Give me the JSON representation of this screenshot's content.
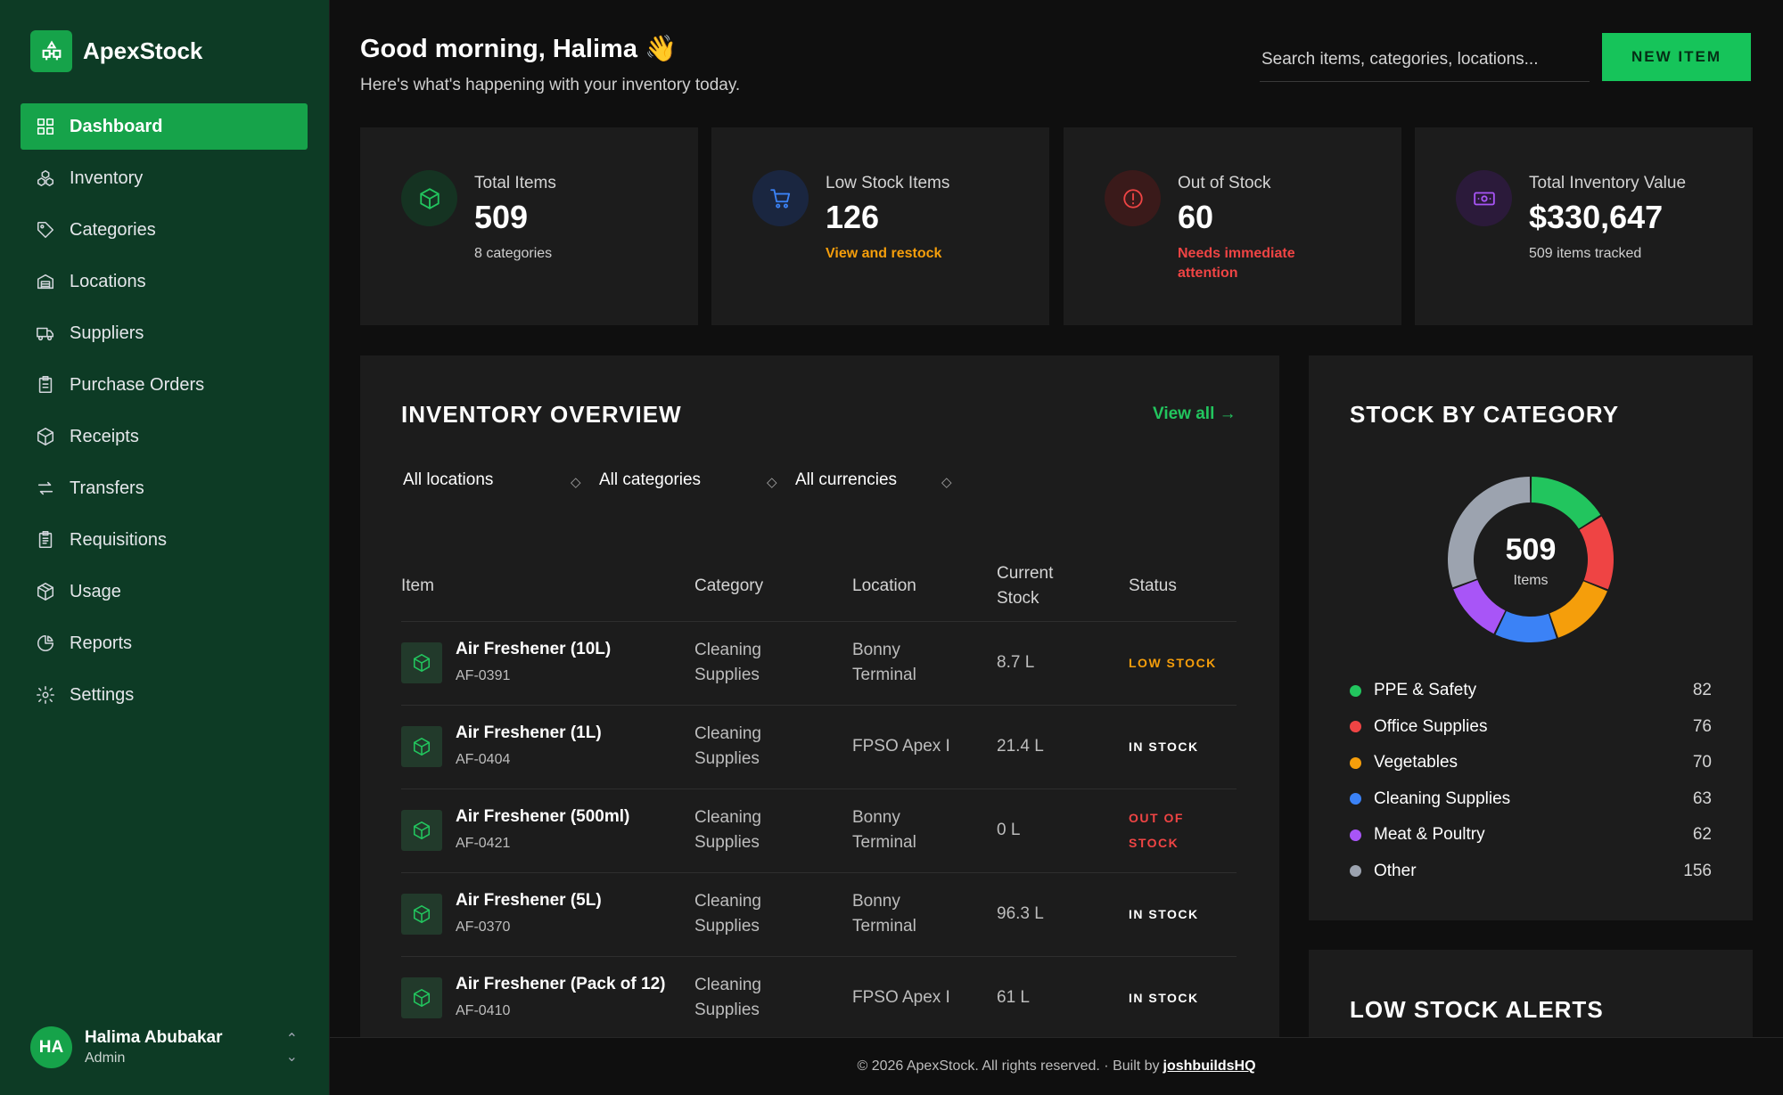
{
  "app": {
    "name": "ApexStock"
  },
  "sidebar": {
    "items": [
      {
        "label": "Dashboard",
        "icon": "dashboard-icon"
      },
      {
        "label": "Inventory",
        "icon": "boxes-icon"
      },
      {
        "label": "Categories",
        "icon": "tag-icon"
      },
      {
        "label": "Locations",
        "icon": "warehouse-icon"
      },
      {
        "label": "Suppliers",
        "icon": "truck-icon"
      },
      {
        "label": "Purchase Orders",
        "icon": "clipboard-icon"
      },
      {
        "label": "Receipts",
        "icon": "package-icon"
      },
      {
        "label": "Transfers",
        "icon": "arrows-icon"
      },
      {
        "label": "Requisitions",
        "icon": "clipboard-list-icon"
      },
      {
        "label": "Usage",
        "icon": "package-open-icon"
      },
      {
        "label": "Reports",
        "icon": "pie-chart-icon"
      },
      {
        "label": "Settings",
        "icon": "gear-icon"
      }
    ],
    "active_index": 0
  },
  "user": {
    "initials": "HA",
    "name": "Halima Abubakar",
    "role": "Admin"
  },
  "header": {
    "greeting": "Good morning, Halima 👋",
    "subtitle": "Here's what's happening with your inventory today.",
    "search_placeholder": "Search items, categories, locations...",
    "new_item_label": "NEW ITEM"
  },
  "stats": [
    {
      "label": "Total Items",
      "value": "509",
      "sub": "8 categories",
      "sub_color": "#cfcfcf",
      "icon": "box-icon",
      "icon_color": "#22c55e",
      "icon_bg": "#153322"
    },
    {
      "label": "Low Stock Items",
      "value": "126",
      "sub": "View and restock",
      "sub_color": "#f59e0b",
      "icon": "cart-icon",
      "icon_color": "#3b82f6",
      "icon_bg": "#1a2640"
    },
    {
      "label": "Out of Stock",
      "value": "60",
      "sub": "Needs immediate attention",
      "sub_color": "#ef4444",
      "icon": "alert-icon",
      "icon_color": "#ef4444",
      "icon_bg": "#3a1a1a"
    },
    {
      "label": "Total Inventory Value",
      "value": "$330,647",
      "sub": "509 items tracked",
      "sub_color": "#cfcfcf",
      "icon": "money-icon",
      "icon_color": "#a855f7",
      "icon_bg": "#2b1a3a"
    }
  ],
  "overview": {
    "title": "INVENTORY OVERVIEW",
    "view_all": "View all →",
    "filters": [
      "All locations",
      "All categories",
      "All currencies"
    ],
    "columns": [
      "Item",
      "Category",
      "Location",
      "Current Stock",
      "Status"
    ],
    "rows": [
      {
        "name": "Air Freshener (10L)",
        "sku": "AF-0391",
        "category": "Cleaning Supplies",
        "location": "Bonny Terminal",
        "stock": "8.7 L",
        "status": "LOW STOCK",
        "status_color": "#f59e0b"
      },
      {
        "name": "Air Freshener (1L)",
        "sku": "AF-0404",
        "category": "Cleaning Supplies",
        "location": "FPSO Apex I",
        "stock": "21.4 L",
        "status": "IN STOCK",
        "status_color": "#ffffff"
      },
      {
        "name": "Air Freshener (500ml)",
        "sku": "AF-0421",
        "category": "Cleaning Supplies",
        "location": "Bonny Terminal",
        "stock": "0 L",
        "status": "OUT OF STOCK",
        "status_color": "#ef4444"
      },
      {
        "name": "Air Freshener (5L)",
        "sku": "AF-0370",
        "category": "Cleaning Supplies",
        "location": "Bonny Terminal",
        "stock": "96.3 L",
        "status": "IN STOCK",
        "status_color": "#ffffff"
      },
      {
        "name": "Air Freshener (Pack of 12)",
        "sku": "AF-0410",
        "category": "Cleaning Supplies",
        "location": "FPSO Apex I",
        "stock": "61 L",
        "status": "IN STOCK",
        "status_color": "#ffffff"
      }
    ]
  },
  "category_panel": {
    "title": "STOCK BY CATEGORY",
    "center_value": "509",
    "center_label": "Items"
  },
  "chart_data": {
    "type": "pie",
    "categories": [
      "PPE & Safety",
      "Office Supplies",
      "Vegetables",
      "Cleaning Supplies",
      "Meat & Poultry",
      "Other"
    ],
    "values": [
      82,
      76,
      70,
      63,
      62,
      156
    ],
    "colors": [
      "#22c55e",
      "#ef4444",
      "#f59e0b",
      "#3b82f6",
      "#a855f7",
      "#9ca3af"
    ]
  },
  "alerts_panel": {
    "title": "LOW STOCK ALERTS"
  },
  "footer": {
    "text": "© 2026 ApexStock. All rights reserved. · Built by",
    "link": "joshbuildsHQ"
  }
}
